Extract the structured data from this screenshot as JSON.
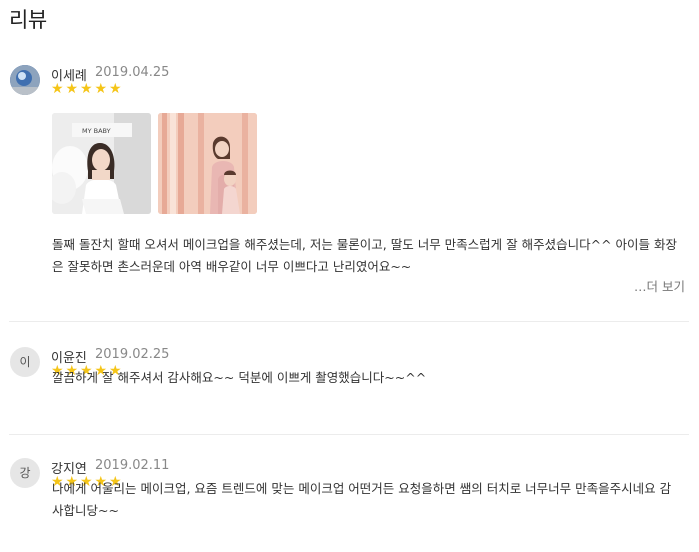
{
  "section": {
    "title": "리뷰"
  },
  "reviews": [
    {
      "name": "이세례",
      "date": "2019.04.25",
      "avatar_initial": "",
      "rating": 5,
      "text": "돌째 돌잔치 할때 오셔서 메이크업을 해주셨는데, 저는 물론이고, 딸도 너무 만족스럽게 잘 해주셨습니다^^ 아이들 화장은 잘못하면 촌스러운데 아역 배우같이 너무 이쁘다고 난리였어요~~",
      "more_label": "…더 보기",
      "photo_sign_text": "MY BABY"
    },
    {
      "name": "이윤진",
      "date": "2019.02.25",
      "avatar_initial": "이",
      "rating": 5,
      "text": "깔끔하게 잘 해주셔서 감사해요~~ 덕분에 이쁘게 촬영했습니다~~^^"
    },
    {
      "name": "강지연",
      "date": "2019.02.11",
      "avatar_initial": "강",
      "rating": 5,
      "text": "나에게 어울리는 메이크업, 요즘 트렌드에 맞는 메이크업 어떤거든 요청을하면 쌤의 터치로 너무너무 만족을주시네요 감사합니당~~"
    }
  ],
  "colors": {
    "star": "#f5c518",
    "divider": "#ececec",
    "date": "#888888"
  },
  "icons": {
    "star": "star-icon"
  }
}
